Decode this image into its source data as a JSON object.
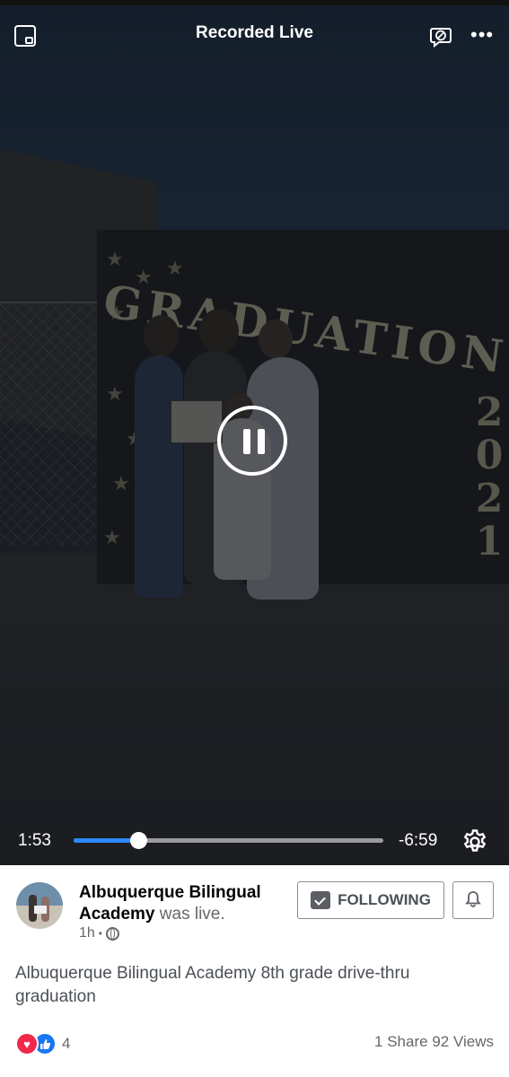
{
  "header": {
    "title": "Recorded Live"
  },
  "player": {
    "elapsed": "1:53",
    "remaining": "-6:59",
    "progress_fraction": 0.21,
    "state": "playing"
  },
  "post": {
    "page_name": "Albuquerque Bilingual Academy",
    "status_text": "was live.",
    "time_ago": "1h",
    "separator": "•",
    "follow_label": "FOLLOWING",
    "description": "Albuquerque Bilingual Academy 8th grade drive-thru graduation",
    "reaction_count": "4",
    "shares": "1 Share",
    "views": "92 Views"
  },
  "scene": {
    "banner_text": "GRADUATION",
    "year_digits": [
      "2",
      "0",
      "2",
      "1"
    ]
  },
  "icons": {
    "pip": "picture-in-picture-icon",
    "no_chat": "hide-comments-icon",
    "more": "more-options-icon",
    "pause": "pause-icon",
    "settings": "gear-icon",
    "check": "following-check-icon",
    "bell": "bell-icon",
    "globe": "globe-icon",
    "love": "love-reaction-icon",
    "like": "like-reaction-icon"
  },
  "colors": {
    "accent": "#2d88ff",
    "video_bg": "#1f2328",
    "love": "#f02849",
    "like": "#1877f2"
  }
}
